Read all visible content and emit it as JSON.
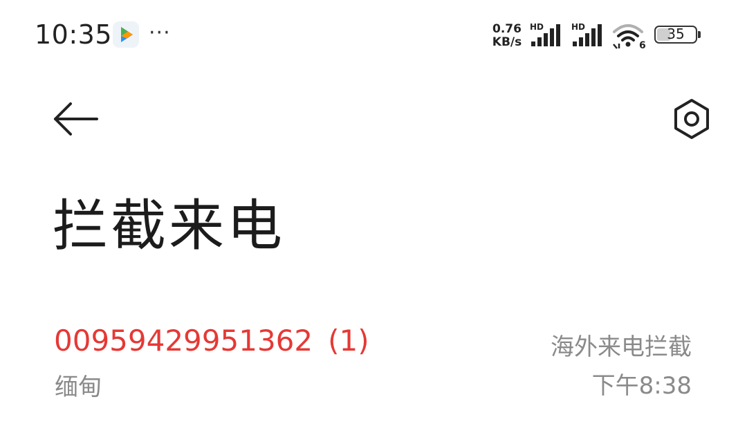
{
  "status_bar": {
    "time": "10:35",
    "more": "···",
    "net_speed_value": "0.76",
    "net_speed_unit": "KB/s",
    "sim1_label": "HD",
    "sim2_label": "HD",
    "wifi_label": "6",
    "battery": "35",
    "battery_level": 0.35
  },
  "header": {
    "back_icon": "arrow-left-icon",
    "settings_icon": "hexagon-settings-icon"
  },
  "page": {
    "title": "拦截来电"
  },
  "calls": [
    {
      "number": "00959429951362",
      "count": "(1)",
      "location": "缅甸",
      "type": "海外来电拦截",
      "time": "下午8:38"
    }
  ],
  "colors": {
    "blocked_number": "#e53935",
    "secondary_text": "#8a8a8a",
    "title_text": "#1c1c1c"
  }
}
